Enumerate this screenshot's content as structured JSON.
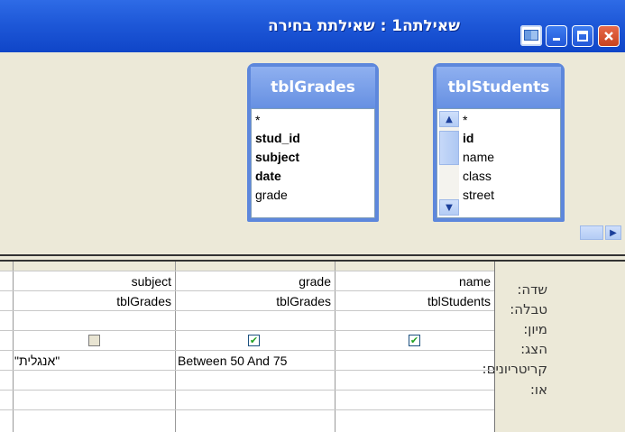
{
  "window": {
    "title": "שאילתה1 : שאילתת בחירה"
  },
  "tables": [
    {
      "name": "tblGrades",
      "fields": [
        {
          "label": "*",
          "bold": false
        },
        {
          "label": "stud_id",
          "bold": true
        },
        {
          "label": "subject",
          "bold": true
        },
        {
          "label": "date",
          "bold": true
        },
        {
          "label": "grade",
          "bold": false
        }
      ]
    },
    {
      "name": "tblStudents",
      "fields": [
        {
          "label": "*",
          "bold": false
        },
        {
          "label": "id",
          "bold": true
        },
        {
          "label": "name",
          "bold": false
        },
        {
          "label": "class",
          "bold": false
        },
        {
          "label": "street",
          "bold": false
        }
      ]
    }
  ],
  "grid": {
    "row_labels": [
      "שדה:",
      "טבלה:",
      "מיון:",
      "הצג:",
      "קריטריונים:",
      "או:"
    ],
    "columns": [
      {
        "field": "subject",
        "table": "tblGrades",
        "sort": "",
        "show": false,
        "criteria": "\"אנגלית\""
      },
      {
        "field": "grade",
        "table": "tblGrades",
        "sort": "",
        "show": true,
        "criteria": "Between 50 And 75"
      },
      {
        "field": "name",
        "table": "tblStudents",
        "sort": "",
        "show": true,
        "criteria": ""
      }
    ]
  },
  "colors": {
    "titlebar": "#0F45C8",
    "table_border": "#5D87DC",
    "checkmark": "#21A121"
  },
  "icons": [
    "window-icon",
    "minimize-icon",
    "maximize-icon",
    "close-icon",
    "scroll-up-icon",
    "scroll-down-icon",
    "scroll-right-icon"
  ]
}
